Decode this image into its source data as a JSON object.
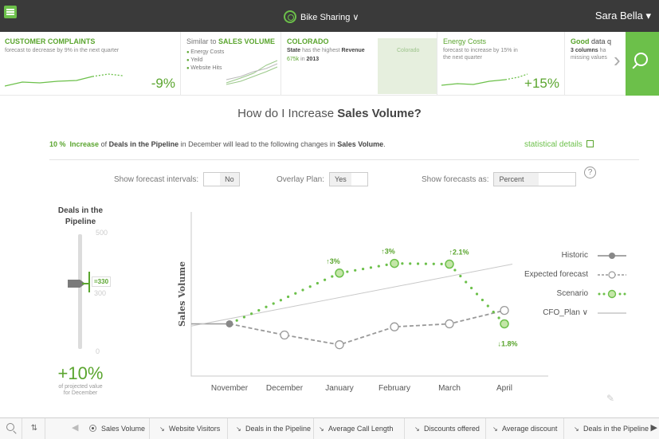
{
  "topbar": {
    "app_title": "Bike Sharing ∨",
    "user": "Sara Bella ▾"
  },
  "cards": {
    "complaints": {
      "title": "CUSTOMER COMPLAINTS",
      "subtitle": "forecast to decrease by 9% in the next quarter",
      "value": "-9%"
    },
    "similar": {
      "title_plain": "Similar to ",
      "title_hl": "SALES VOLUME",
      "items": [
        "Energy Costs",
        "Yeild",
        "Website Hits"
      ]
    },
    "colorado": {
      "title": "COLORADO",
      "line1_bold": "State",
      "line1_rest": " has the highest ",
      "line1_bold2": "Revenue",
      "line2_hl": "675k",
      "line2_rest": " in ",
      "line2_bold": "2013",
      "map_label": "Colorado"
    },
    "energy": {
      "title": "Energy Costs",
      "subtitle_1": "forecast to increase by 15% in",
      "subtitle_2": "the next quarter",
      "value": "+15%"
    },
    "good_data": {
      "title_hl": "Good",
      "title_rest": " data q",
      "line1_bold": "3 columns",
      "line1_rest": " ha",
      "line2": "missing values"
    }
  },
  "question": {
    "prefix": "How do I Increase ",
    "bold": "Sales Volume?"
  },
  "scenario": {
    "pct": "10 %",
    "direction": "Increase",
    "t1": " of ",
    "b1": "Deals in the Pipeline",
    "t2": " in December will lead to the following changes in ",
    "b2": "Sales Volume",
    "t3": ".",
    "details_link": "statistical details"
  },
  "options": {
    "intervals_label": "Show forecast intervals:",
    "intervals_value": "No",
    "overlay_label": "Overlay Plan:",
    "overlay_value": "Yes",
    "forecasts_label": "Show forecasts as:",
    "forecasts_value": "Percent",
    "help": "?"
  },
  "slider": {
    "title": "Deals in the Pipeline",
    "tick_high": "500",
    "tick_mid": "300",
    "tick_low": "0",
    "handle_value": "=330",
    "level": 0.66,
    "pct": "+10%",
    "caption_1": "of projected value",
    "caption_2": "for December"
  },
  "chart_data": {
    "type": "line",
    "ylabel": "Sales Volume",
    "categories": [
      "November",
      "December",
      "January",
      "February",
      "March",
      "April"
    ],
    "series": [
      {
        "name": "Historic",
        "x": [
          0
        ],
        "y": [
          0
        ]
      },
      {
        "name": "Expected forecast",
        "x": [
          0,
          1,
          2,
          3,
          4,
          5
        ],
        "y": [
          0,
          -1.5,
          -2.8,
          -0.4,
          0,
          1.8
        ]
      },
      {
        "name": "Scenario",
        "x": [
          0,
          2,
          3,
          4,
          5
        ],
        "y": [
          0,
          6.8,
          8.1,
          8.0,
          0
        ],
        "labels": [
          "",
          "↑3%",
          "↑3%",
          "↑2.1%",
          "↓1.8%"
        ]
      },
      {
        "name": "CFO_Plan",
        "x": [
          0,
          5
        ],
        "y": [
          0,
          8
        ]
      }
    ],
    "label_color": "#5aa52e"
  },
  "legend": {
    "historic": "Historic",
    "expected": "Expected forecast",
    "scenario": "Scenario",
    "plan": "CFO_Plan ∨"
  },
  "bottom_tabs": [
    {
      "label": "Sales Volume",
      "icon": "radio"
    },
    {
      "label": "Website Visitors",
      "icon": "trend-icon"
    },
    {
      "label": "Deals in the Pipeline",
      "icon": "trend-icon"
    },
    {
      "label": "Average Call Length",
      "icon": "trend-icon"
    },
    {
      "label": "Discounts offered",
      "icon": "trend-icon"
    },
    {
      "label": "Average discount",
      "icon": "trend-icon"
    },
    {
      "label": "Deals in the Pipeline",
      "icon": "trend-icon"
    }
  ],
  "colors": {
    "accent": "#6cc04a",
    "accent_dark": "#5aa52e",
    "topbar": "#3a3a3a",
    "forecast": "#999999"
  }
}
